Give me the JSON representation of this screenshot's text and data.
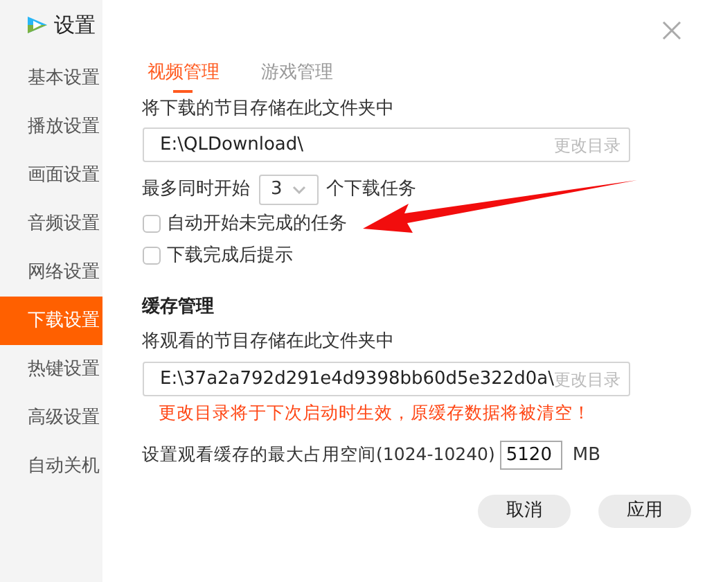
{
  "window": {
    "title": "设置"
  },
  "sidebar": {
    "items": [
      {
        "label": "基本设置",
        "selected": false
      },
      {
        "label": "播放设置",
        "selected": false
      },
      {
        "label": "画面设置",
        "selected": false
      },
      {
        "label": "音频设置",
        "selected": false
      },
      {
        "label": "网络设置",
        "selected": false
      },
      {
        "label": "下载设置",
        "selected": true
      },
      {
        "label": "热键设置",
        "selected": false
      },
      {
        "label": "高级设置",
        "selected": false
      },
      {
        "label": "自动关机",
        "selected": false
      }
    ]
  },
  "tabs": [
    {
      "label": "视频管理",
      "selected": true
    },
    {
      "label": "游戏管理",
      "selected": false
    }
  ],
  "download": {
    "folder_label": "将下载的节目存储在此文件夹中",
    "folder_path": "E:\\QLDownload\\",
    "change_button": "更改目录",
    "max_prefix": "最多同时开始",
    "max_value": "3",
    "max_suffix": "个下载任务",
    "checkboxes": [
      {
        "label": "自动开始未完成的任务",
        "checked": false
      },
      {
        "label": "下载完成后提示",
        "checked": false
      }
    ]
  },
  "cache": {
    "heading": "缓存管理",
    "folder_label": "将观看的节目存储在此文件夹中",
    "folder_path": "E:\\37a2a792d291e4d9398bb60d5e322d0a\\",
    "change_button": "更改目录",
    "warning": "更改目录将于下次启动时生效，原缓存数据将被清空！",
    "size_label": "设置观看缓存的最大占用空间(1024-10240)",
    "size_value": "5120",
    "size_unit": "MB"
  },
  "buttons": [
    {
      "label": "取消"
    },
    {
      "label": "应用"
    }
  ]
}
